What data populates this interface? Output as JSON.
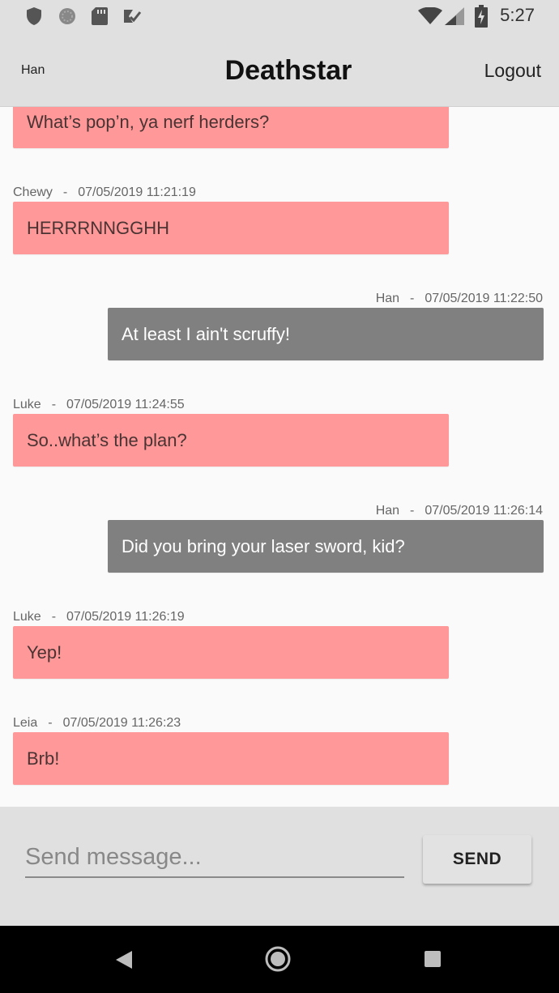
{
  "status_bar": {
    "time": "5:27",
    "icons": [
      "shield-icon",
      "sync-icon",
      "sd-card-icon",
      "checklist-icon",
      "wifi-icon",
      "signal-icon",
      "battery-icon"
    ]
  },
  "header": {
    "user": "Han",
    "title": "Deathstar",
    "logout_label": "Logout"
  },
  "messages": [
    {
      "author": "",
      "time": "",
      "text": "What’s pop’n, ya nerf herders?",
      "mine": false
    },
    {
      "author": "Chewy",
      "time": "07/05/2019 11:21:19",
      "text": "HERRRNNGGHH",
      "mine": false
    },
    {
      "author": "Han",
      "time": "07/05/2019 11:22:50",
      "text": "At least I ain't scruffy!",
      "mine": true
    },
    {
      "author": "Luke",
      "time": "07/05/2019 11:24:55",
      "text": "So..what’s the plan?",
      "mine": false
    },
    {
      "author": "Han",
      "time": "07/05/2019 11:26:14",
      "text": "Did you bring your laser sword, kid?",
      "mine": true
    },
    {
      "author": "Luke",
      "time": "07/05/2019 11:26:19",
      "text": "Yep!",
      "mine": false
    },
    {
      "author": "Leia",
      "time": "07/05/2019 11:26:23",
      "text": "Brb!",
      "mine": false
    }
  ],
  "meta_separator": "-",
  "composer": {
    "placeholder": "Send message...",
    "value": "",
    "send_label": "SEND"
  },
  "nav_bar": {
    "icons": [
      "back-icon",
      "home-icon",
      "recents-icon"
    ]
  },
  "colors": {
    "other_bubble": "#ff9999",
    "mine_bubble": "#808080",
    "header_bg": "#e0e0e0"
  }
}
